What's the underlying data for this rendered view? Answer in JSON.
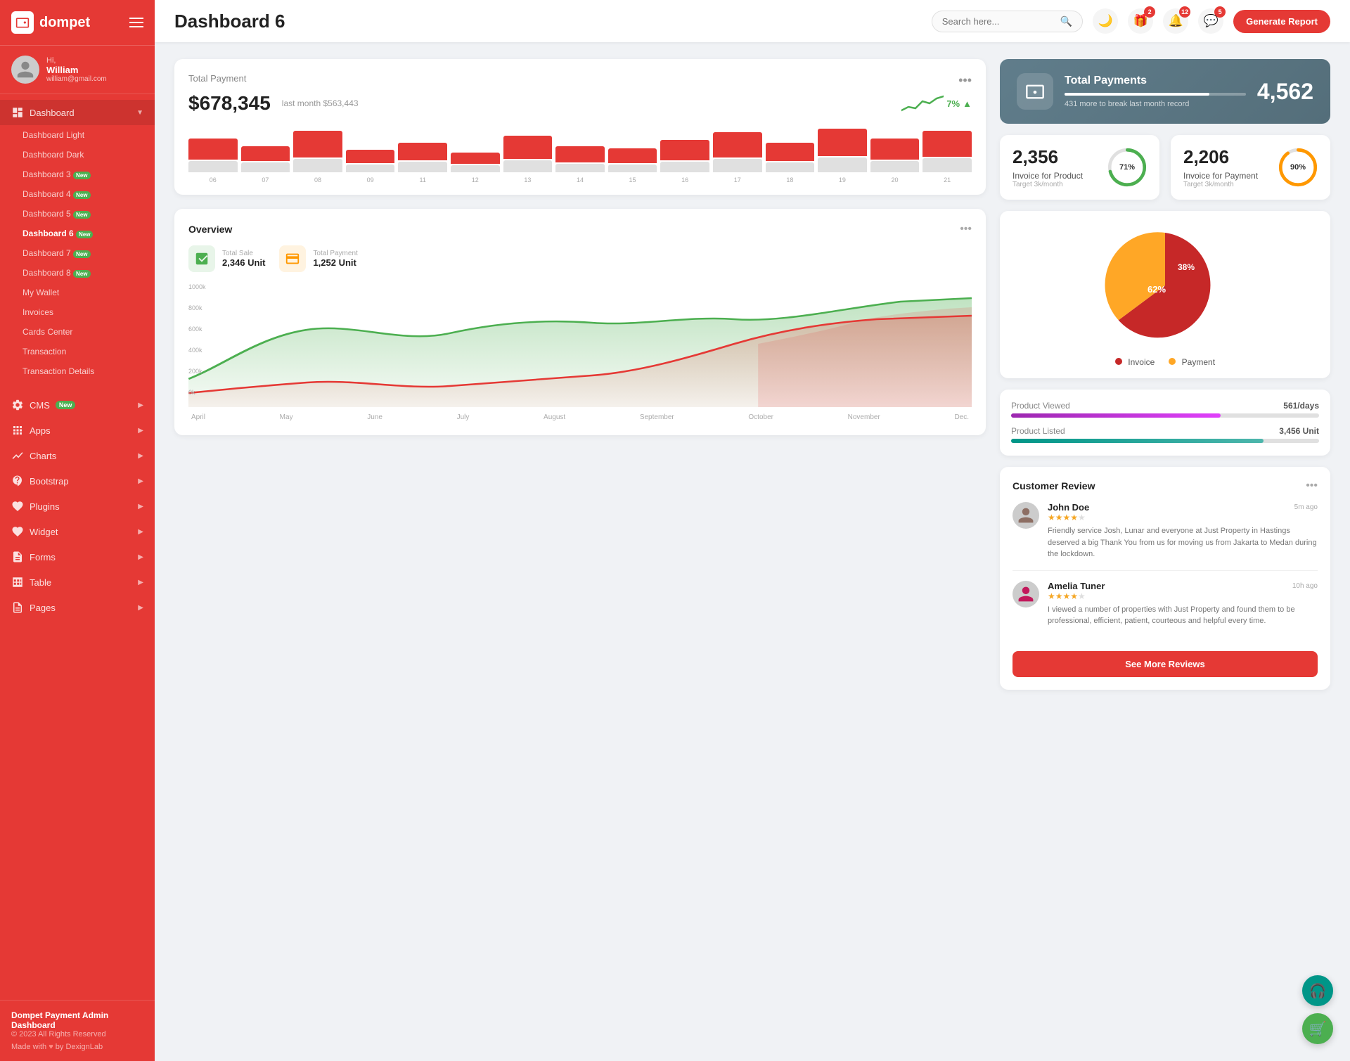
{
  "app": {
    "logo": "dompet",
    "logo_icon": "wallet"
  },
  "user": {
    "greeting": "Hi, William",
    "name": "William",
    "email": "william@gmail.com"
  },
  "sidebar": {
    "dashboard_label": "Dashboard",
    "items": [
      {
        "label": "Dashboard Light",
        "id": "dashboard-light",
        "has_sub": false
      },
      {
        "label": "Dashboard Dark",
        "id": "dashboard-dark",
        "has_sub": false
      },
      {
        "label": "Dashboard 3",
        "id": "dashboard-3",
        "badge": "New",
        "has_sub": false
      },
      {
        "label": "Dashboard 4",
        "id": "dashboard-4",
        "badge": "New",
        "has_sub": false
      },
      {
        "label": "Dashboard 5",
        "id": "dashboard-5",
        "badge": "New",
        "has_sub": false
      },
      {
        "label": "Dashboard 6",
        "id": "dashboard-6",
        "badge": "New",
        "active": true,
        "has_sub": false
      },
      {
        "label": "Dashboard 7",
        "id": "dashboard-7",
        "badge": "New",
        "has_sub": false
      },
      {
        "label": "Dashboard 8",
        "id": "dashboard-8",
        "badge": "New",
        "has_sub": false
      },
      {
        "label": "My Wallet",
        "id": "my-wallet",
        "has_sub": false
      },
      {
        "label": "Invoices",
        "id": "invoices",
        "has_sub": false
      },
      {
        "label": "Cards Center",
        "id": "cards-center",
        "has_sub": false
      },
      {
        "label": "Transaction",
        "id": "transaction",
        "has_sub": false
      },
      {
        "label": "Transaction Details",
        "id": "transaction-details",
        "has_sub": false
      }
    ],
    "nav_items": [
      {
        "label": "CMS",
        "id": "cms",
        "badge": "New",
        "has_arrow": true
      },
      {
        "label": "Apps",
        "id": "apps",
        "has_arrow": true
      },
      {
        "label": "Charts",
        "id": "charts",
        "has_arrow": true
      },
      {
        "label": "Bootstrap",
        "id": "bootstrap",
        "has_arrow": true
      },
      {
        "label": "Plugins",
        "id": "plugins",
        "has_arrow": true
      },
      {
        "label": "Widget",
        "id": "widget",
        "has_arrow": true
      },
      {
        "label": "Forms",
        "id": "forms",
        "has_arrow": true
      },
      {
        "label": "Table",
        "id": "table",
        "has_arrow": true
      },
      {
        "label": "Pages",
        "id": "pages",
        "has_arrow": true
      }
    ],
    "footer_brand": "Dompet Payment Admin Dashboard",
    "footer_copy": "© 2023 All Rights Reserved",
    "footer_made": "Made with",
    "footer_by": "by DexignLab"
  },
  "topbar": {
    "page_title": "Dashboard 6",
    "search_placeholder": "Search here...",
    "generate_btn": "Generate Report",
    "notifications": [
      {
        "id": "gift",
        "count": 2
      },
      {
        "id": "bell",
        "count": 12
      },
      {
        "id": "message",
        "count": 5
      }
    ]
  },
  "total_payment": {
    "title": "Total Payment",
    "amount": "$678,345",
    "last_month_label": "last month $563,443",
    "trend_pct": "7%",
    "more_icon": "...",
    "bars": [
      {
        "label": "06",
        "h_red": 55,
        "h_grey": 30
      },
      {
        "label": "07",
        "h_red": 40,
        "h_grey": 25
      },
      {
        "label": "08",
        "h_red": 70,
        "h_grey": 35
      },
      {
        "label": "09",
        "h_red": 35,
        "h_grey": 20
      },
      {
        "label": "11",
        "h_red": 45,
        "h_grey": 28
      },
      {
        "label": "12",
        "h_red": 30,
        "h_grey": 18
      },
      {
        "label": "13",
        "h_red": 60,
        "h_grey": 32
      },
      {
        "label": "14",
        "h_red": 42,
        "h_grey": 22
      },
      {
        "label": "15",
        "h_red": 38,
        "h_grey": 20
      },
      {
        "label": "16",
        "h_red": 52,
        "h_grey": 28
      },
      {
        "label": "17",
        "h_red": 65,
        "h_grey": 35
      },
      {
        "label": "18",
        "h_red": 48,
        "h_grey": 25
      },
      {
        "label": "19",
        "h_red": 72,
        "h_grey": 38
      },
      {
        "label": "20",
        "h_red": 55,
        "h_grey": 30
      },
      {
        "label": "21",
        "h_red": 68,
        "h_grey": 36
      }
    ]
  },
  "total_payments_blue": {
    "title": "Total Payments",
    "sub": "431 more to break last month record",
    "number": "4,562",
    "bar_pct": 80
  },
  "invoice_product": {
    "number": "2,356",
    "label": "Invoice for Product",
    "target": "Target 3k/month",
    "pct": 71,
    "color": "#4caf50"
  },
  "invoice_payment": {
    "number": "2,206",
    "label": "Invoice for Payment",
    "target": "Target 3k/month",
    "pct": 90,
    "color": "#ff9800"
  },
  "overview": {
    "title": "Overview",
    "total_sale_label": "Total Sale",
    "total_sale_value": "2,346 Unit",
    "total_payment_label": "Total Payment",
    "total_payment_value": "1,252 Unit",
    "months": [
      "April",
      "May",
      "June",
      "July",
      "August",
      "September",
      "October",
      "November",
      "Dec."
    ],
    "y_labels": [
      "1000k",
      "800k",
      "600k",
      "400k",
      "200k",
      "0k"
    ]
  },
  "pie_chart": {
    "invoice_pct": 62,
    "payment_pct": 38,
    "invoice_color": "#c62828",
    "payment_color": "#ffa726",
    "invoice_label": "Invoice",
    "payment_label": "Payment"
  },
  "product_stats": [
    {
      "label": "Product Viewed",
      "value": "561/days",
      "bar_pct": 68,
      "color": "purple"
    },
    {
      "label": "Product Listed",
      "value": "3,456 Unit",
      "bar_pct": 82,
      "color": "teal"
    }
  ],
  "customer_review": {
    "title": "Customer Review",
    "reviews": [
      {
        "name": "John Doe",
        "time": "5m ago",
        "stars": 4,
        "text": "Friendly service Josh, Lunar and everyone at Just Property in Hastings deserved a big Thank You from us for moving us from Jakarta to Medan during the lockdown."
      },
      {
        "name": "Amelia Tuner",
        "time": "10h ago",
        "stars": 4,
        "text": "I viewed a number of properties with Just Property and found them to be professional, efficient, patient, courteous and helpful every time."
      }
    ],
    "see_more_btn": "See More Reviews"
  }
}
